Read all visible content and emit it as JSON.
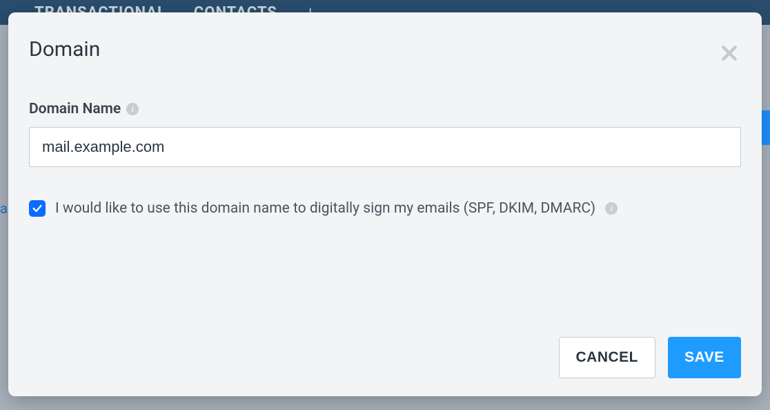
{
  "nav": {
    "items": [
      "Transactional",
      "Contacts"
    ]
  },
  "modal": {
    "title": "Domain",
    "domain_field": {
      "label": "Domain Name",
      "value": "mail.example.com"
    },
    "sign_checkbox": {
      "checked": true,
      "label": "I would like to use this domain name to digitally sign my emails (SPF, DKIM, DMARC)"
    },
    "buttons": {
      "cancel": "CANCEL",
      "save": "SAVE"
    }
  },
  "colors": {
    "primary": "#1e9bff",
    "checkbox": "#0b6cff",
    "navbar": "#2a4d6e",
    "modal_bg": "#f3f4f5"
  }
}
